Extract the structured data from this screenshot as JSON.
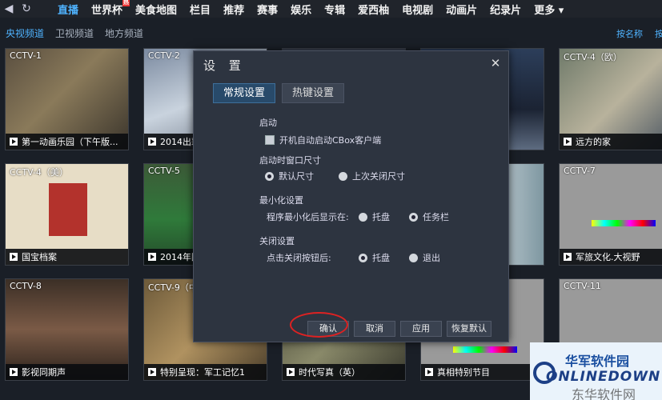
{
  "topnav": {
    "items": [
      {
        "label": "直播",
        "active": true
      },
      {
        "label": "世界杯",
        "badge": "热"
      },
      {
        "label": "美食地图"
      },
      {
        "label": "栏目"
      },
      {
        "label": "推荐"
      },
      {
        "label": "赛事"
      },
      {
        "label": "娱乐"
      },
      {
        "label": "专辑"
      },
      {
        "label": "爱西柚"
      },
      {
        "label": "电视剧"
      },
      {
        "label": "动画片"
      },
      {
        "label": "纪录片"
      },
      {
        "label": "更多 ▾"
      }
    ]
  },
  "subnav": {
    "tabs": [
      "央视频道",
      "卫视频道",
      "地方频道"
    ],
    "sort": "按名称",
    "sort2": "按"
  },
  "channels": [
    {
      "name": "CCTV-1",
      "program": "第一动画乐园（下午版..."
    },
    {
      "name": "CCTV-2",
      "program": "2014出彩"
    },
    {
      "name": "",
      "program": ""
    },
    {
      "name": "",
      "program": ""
    },
    {
      "name": "CCTV-4（欧）",
      "program": "远方的家"
    },
    {
      "name": "CCTV-4（美）",
      "program": "国宝档案"
    },
    {
      "name": "CCTV-5",
      "program": "2014年圆"
    },
    {
      "name": "",
      "program": ""
    },
    {
      "name": "",
      "program": ""
    },
    {
      "name": "CCTV-7",
      "program": "军旅文化.大视野"
    },
    {
      "name": "CCTV-8",
      "program": "影视同期声"
    },
    {
      "name": "CCTV-9（中",
      "program": "特别呈现：军工记忆1"
    },
    {
      "name": "",
      "program": "时代写真（英）"
    },
    {
      "name": "",
      "program": "真相特别节目"
    },
    {
      "name": "CCTV-11",
      "program": ""
    }
  ],
  "dialog": {
    "title": "设 置",
    "tabs": [
      "常规设置",
      "热键设置"
    ],
    "startup": {
      "section": "启动",
      "autostart": "开机自动启动CBox客户端"
    },
    "window_size": {
      "section": "启动时窗口尺寸",
      "default": "默认尺寸",
      "last": "上次关闭尺寸"
    },
    "minimize": {
      "section": "最小化设置",
      "lead": "程序最小化后显示在:",
      "tray": "托盘",
      "taskbar": "任务栏"
    },
    "close": {
      "section": "关闭设置",
      "lead": "点击关闭按钮后:",
      "tray": "托盘",
      "exit": "退出"
    },
    "buttons": {
      "confirm": "确认",
      "cancel": "取消",
      "apply": "应用",
      "restore": "恢复默认"
    }
  },
  "watermark": {
    "cn": "华军软件园",
    "en": "ONLINEDOWN",
    "bottom": "东华软件网"
  },
  "colors": {
    "accent": "#4fb3ff",
    "highlight_ring": "#dd2222",
    "dialog_bg": "#2d3440"
  }
}
